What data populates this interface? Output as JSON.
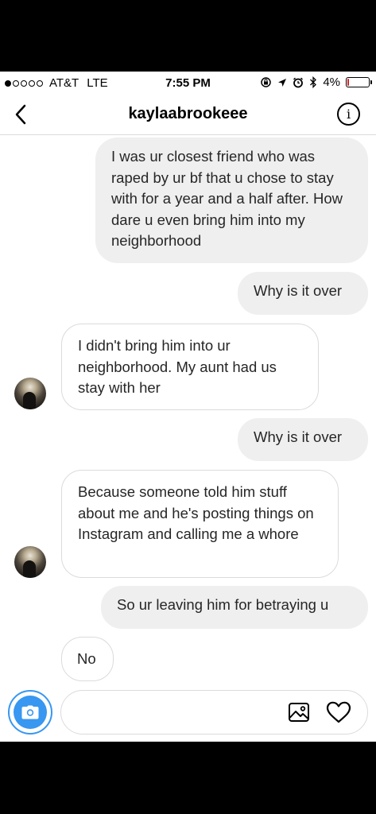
{
  "status_bar": {
    "carrier": "AT&T",
    "network": "LTE",
    "time": "7:55 PM",
    "battery": "4%",
    "battery_level": 0.04,
    "signal_bars_filled": 1,
    "signal_bars_total": 5
  },
  "header": {
    "title": "kaylaabrookeee",
    "info_label": "i"
  },
  "messages": [
    {
      "sender": "me",
      "text": "I was ur closest friend who was raped by ur bf that u chose to stay with for a year and a half after. How dare u even bring him into my neighborhood"
    },
    {
      "sender": "me",
      "text": "Why is it over"
    },
    {
      "sender": "them",
      "text": "I didn't bring him into ur neighborhood. My aunt had us stay with her"
    },
    {
      "sender": "me",
      "text": "Why is it over"
    },
    {
      "sender": "them",
      "text": "Because someone told him stuff about me and he's posting things on Instagram and calling me a whore"
    },
    {
      "sender": "me",
      "text": "So ur leaving him for betraying u"
    },
    {
      "sender": "them",
      "text": "No"
    }
  ],
  "composer": {
    "placeholder": "",
    "value": ""
  },
  "colors": {
    "accent": "#3897f0",
    "outgoing_bubble": "#efefef",
    "incoming_border": "#dbdbdb",
    "battery_low": "#e02020"
  },
  "icons": {
    "back": "chevron-left-icon",
    "info": "info-icon",
    "camera": "camera-icon",
    "gallery": "image-icon",
    "like": "heart-icon"
  }
}
